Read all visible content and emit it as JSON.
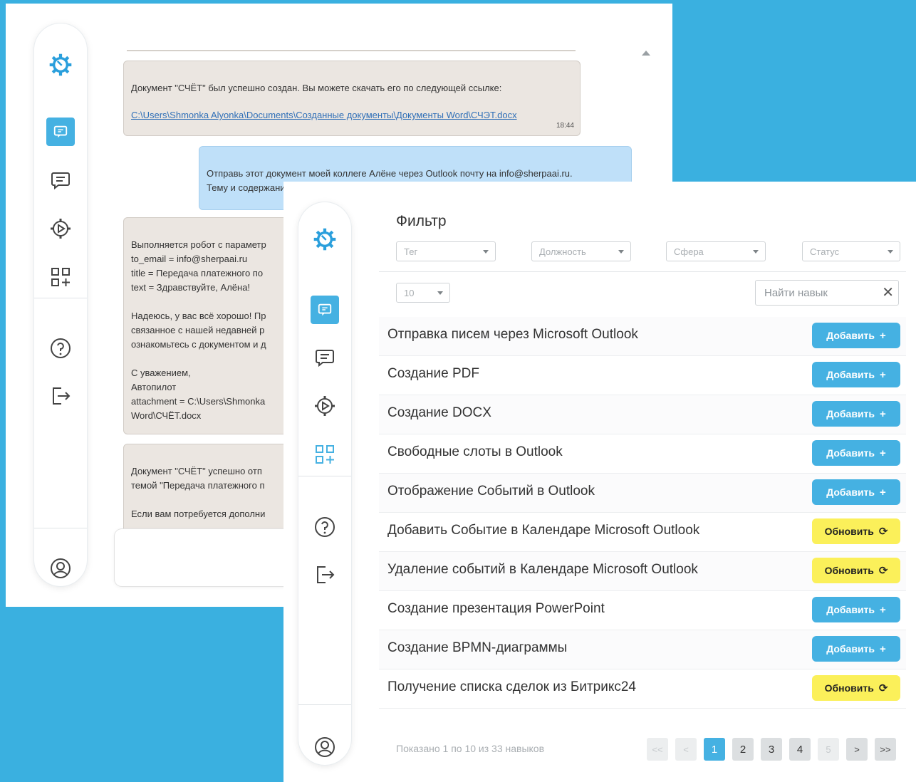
{
  "chat": {
    "messages": [
      {
        "role": "bot",
        "text": "Документ \"СЧЁТ\" был успешно создан. Вы можете скачать его по следующей ссылке:",
        "link": "C:\\Users\\Shmonka Alyonka\\Documents\\Созданные документы\\Документы Word\\СЧЭТ.docx",
        "time": "18:44"
      },
      {
        "role": "user",
        "text": "Отправь этот документ моей коллеге Алёне через Outlook почту на info@sherpaai.ru.\nТему и содержание письма придумай сам, напиши сто-то хорошее"
      },
      {
        "role": "bot",
        "text": "Выполняется робот с параметр\nto_email = info@sherpaai.ru\ntitle = Передача платежного по\ntext = Здравствуйте, Алёна!\n\nНадеюсь, у вас всё хорошо! Пр\nсвязанное с нашей недавней р\nознакомьтесь с документом и д\n\nС уважением,\nАвтопилот\nattachment = C:\\Users\\Shmonka\nWord\\СЧЁТ.docx"
      },
      {
        "role": "bot",
        "text": "Документ \"СЧЁТ\" успешно отп\nтемой \"Передача платежного п\n\nЕсли вам потребуется дополни"
      }
    ]
  },
  "filter": {
    "title": "Фильтр",
    "tag": "Тег",
    "position": "Должность",
    "sphere": "Сфера",
    "status": "Статус",
    "page_size": "10",
    "search_placeholder": "Найти навык",
    "clear_symbol": "✕"
  },
  "skills": [
    {
      "name": "Отправка писем через Microsoft Outlook",
      "action": "Добавить",
      "symbol": "+",
      "kind": "add"
    },
    {
      "name": "Создание PDF",
      "action": "Добавить",
      "symbol": "+",
      "kind": "add"
    },
    {
      "name": "Создание DOCX",
      "action": "Добавить",
      "symbol": "+",
      "kind": "add"
    },
    {
      "name": "Свободные слоты в Outlook",
      "action": "Добавить",
      "symbol": "+",
      "kind": "add"
    },
    {
      "name": "Отображение Событий в Outlook",
      "action": "Добавить",
      "symbol": "+",
      "kind": "add"
    },
    {
      "name": "Добавить Событие в Календаре Microsoft Outlook",
      "action": "Обновить",
      "symbol": "⟳",
      "kind": "update"
    },
    {
      "name": "Удаление событий в Календаре Microsoft Outlook",
      "action": "Обновить",
      "symbol": "⟳",
      "kind": "update"
    },
    {
      "name": "Создание презентация PowerPoint",
      "action": "Добавить",
      "symbol": "+",
      "kind": "add"
    },
    {
      "name": "Создание BPMN-диаграммы",
      "action": "Добавить",
      "symbol": "+",
      "kind": "add"
    },
    {
      "name": "Получение списка сделок из Битрикс24",
      "action": "Обновить",
      "symbol": "⟳",
      "kind": "update"
    }
  ],
  "pagination": {
    "info": "Показано 1 по 10 из 33 навыков",
    "first": "<<",
    "prev": "<",
    "pages": [
      "1",
      "2",
      "3",
      "4"
    ],
    "current": "1",
    "gap": "5",
    "next": ">",
    "last": ">>"
  },
  "colors": {
    "accent": "#45b1e2",
    "update": "#fbf05a",
    "background": "#3ab0e0"
  }
}
